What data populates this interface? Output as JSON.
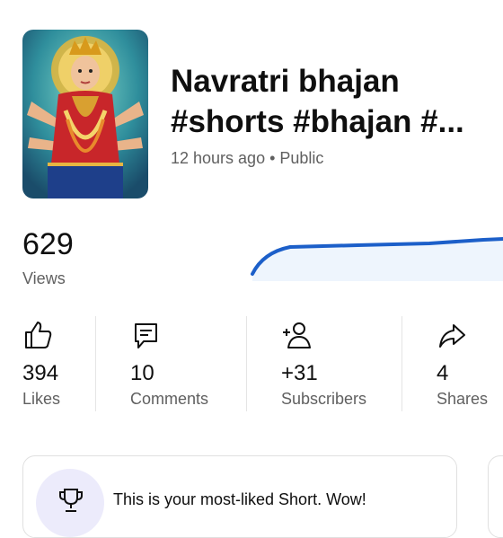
{
  "video": {
    "title": "Navratri bhajan #shorts #bhajan #...",
    "meta": "12 hours ago • Public"
  },
  "views": {
    "count": "629",
    "label": "Views"
  },
  "views_trend": {
    "type": "line",
    "color": "#1c5fc9",
    "fill": "#eef5fd"
  },
  "stats": [
    {
      "icon": "thumbs-up-icon",
      "value": "394",
      "label": "Likes"
    },
    {
      "icon": "comment-icon",
      "value": "10",
      "label": "Comments"
    },
    {
      "icon": "add-person-icon",
      "value": "+31",
      "label": "Subscribers"
    },
    {
      "icon": "share-icon",
      "value": "4",
      "label": "Shares"
    }
  ],
  "insight": {
    "icon": "trophy-icon",
    "text": "This is your most-liked Short. Wow!"
  },
  "colors": {
    "text": "#0f0f0f",
    "secondary": "#606060",
    "accent": "#1c5fc9",
    "badge_bg": "#ecebfb"
  }
}
